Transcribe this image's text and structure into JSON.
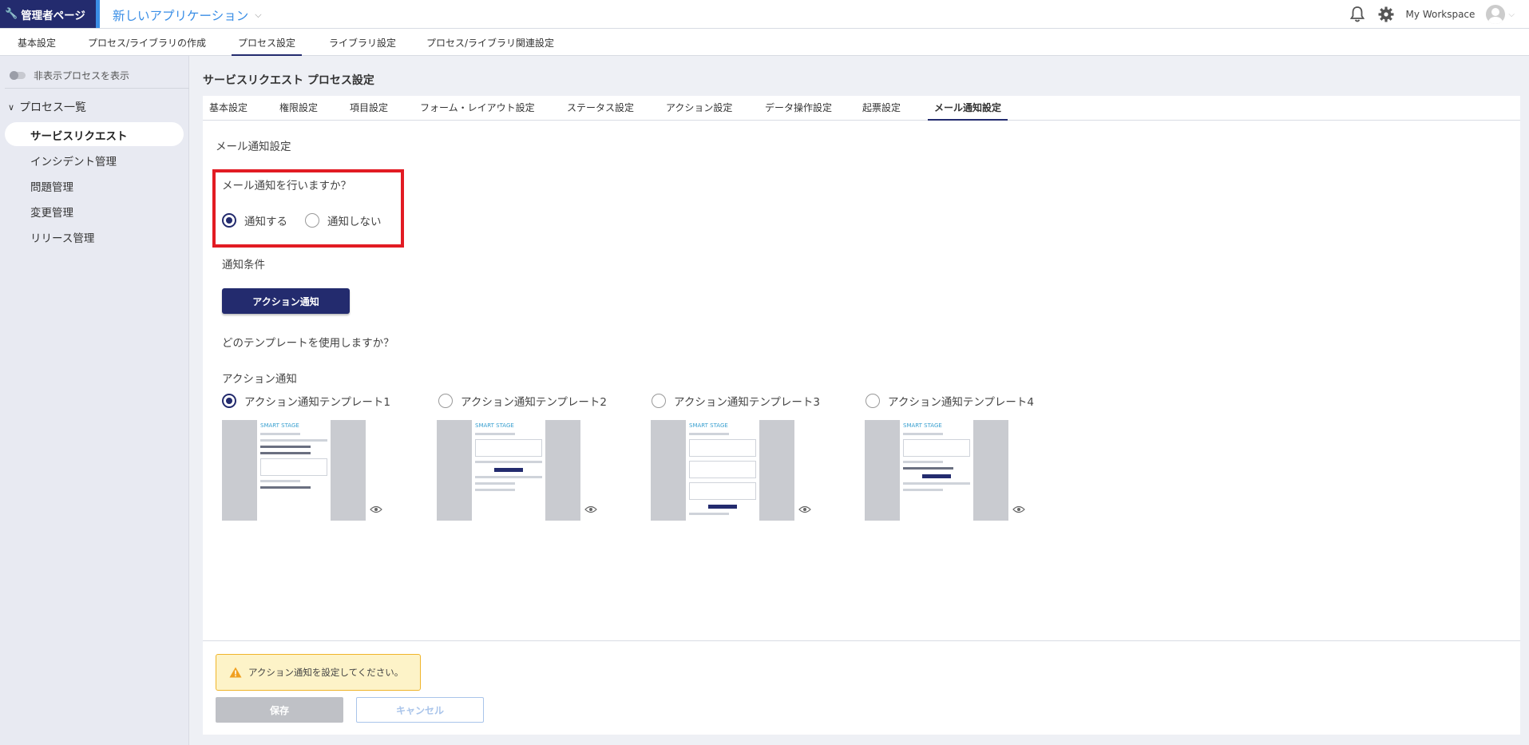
{
  "header": {
    "admin_label": "管理者ページ",
    "app_title": "新しいアプリケーション",
    "workspace": "My Workspace"
  },
  "subnav": {
    "items": [
      "基本設定",
      "プロセス/ライブラリの作成",
      "プロセス設定",
      "ライブラリ設定",
      "プロセス/ライブラリ関連設定"
    ],
    "active": "プロセス設定"
  },
  "sidebar": {
    "toggle_label": "非表示プロセスを表示",
    "group_label": "プロセス一覧",
    "items": [
      "サービスリクエスト",
      "インシデント管理",
      "問題管理",
      "変更管理",
      "リリース管理"
    ],
    "active": "サービスリクエスト"
  },
  "main": {
    "heading": "サービスリクエスト プロセス設定",
    "tabs": [
      "基本設定",
      "権限設定",
      "項目設定",
      "フォーム・レイアウト設定",
      "ステータス設定",
      "アクション設定",
      "データ操作設定",
      "起票設定",
      "メール通知設定"
    ],
    "active_tab": "メール通知設定",
    "section_title": "メール通知設定",
    "notify_question": "メール通知を行いますか？",
    "notify_options": [
      "通知する",
      "通知しない"
    ],
    "notify_selected": "通知する",
    "condition_label": "通知条件",
    "action_button": "アクション通知",
    "template_question": "どのテンプレートを使用しますか？",
    "template_group_label": "アクション通知",
    "templates": [
      "アクション通知テンプレート1",
      "アクション通知テンプレート2",
      "アクション通知テンプレート3",
      "アクション通知テンプレート4"
    ],
    "template_selected": "アクション通知テンプレート1",
    "thumbnail_brand": "SMART STAGE",
    "warning_text": "アクション通知を設定してください。",
    "save_label": "保存",
    "cancel_label": "キャンセル"
  },
  "colors": {
    "primary": "#232b6e",
    "accent": "#3a8ee6",
    "highlight": "#e21b23",
    "warning_bg": "#fdf3c8",
    "warning_border": "#f0b52a"
  }
}
